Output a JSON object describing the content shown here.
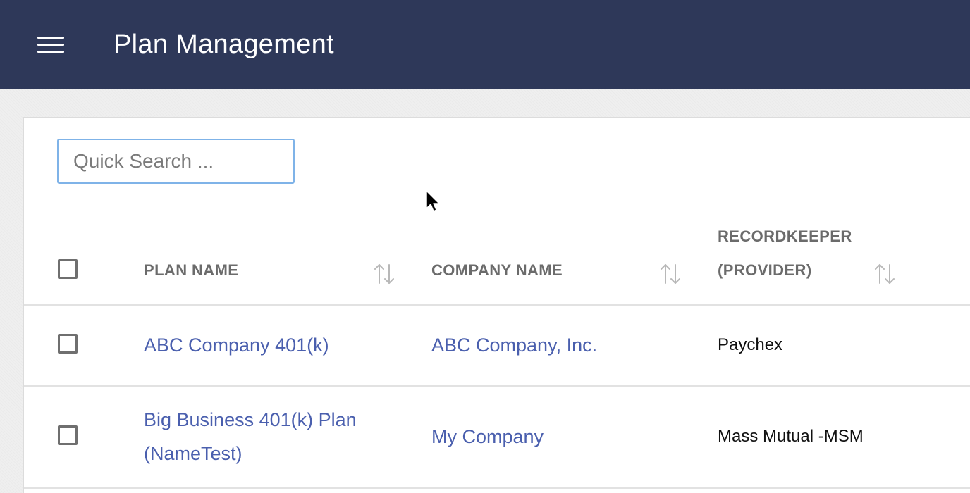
{
  "header": {
    "menu_icon": "hamburger-menu-icon",
    "title": "Plan Management",
    "background": "#2e3859"
  },
  "search": {
    "placeholder": "Quick Search ...",
    "value": ""
  },
  "table": {
    "columns": [
      {
        "label": "PLAN NAME",
        "sortable": true
      },
      {
        "label": "COMPANY NAME",
        "sortable": true
      },
      {
        "label_line1": "RECORDKEEPER",
        "label_line2": "(PROVIDER)",
        "sortable": true
      }
    ],
    "rows": [
      {
        "plan_name": "ABC Company 401(k)",
        "company_name": "ABC Company, Inc.",
        "recordkeeper": "Paychex"
      },
      {
        "plan_name_line1": "Big Business 401(k) Plan",
        "plan_name_line2": "(NameTest)",
        "company_name": "My Company",
        "recordkeeper": "Mass Mutual -MSM"
      }
    ]
  },
  "colors": {
    "link": "#4a5fae",
    "header_text": "#6b6b6b",
    "search_border": "#7fb3e8"
  },
  "icons": {
    "sort": "sort-arrows-icon",
    "cursor": "mouse-pointer-icon"
  }
}
